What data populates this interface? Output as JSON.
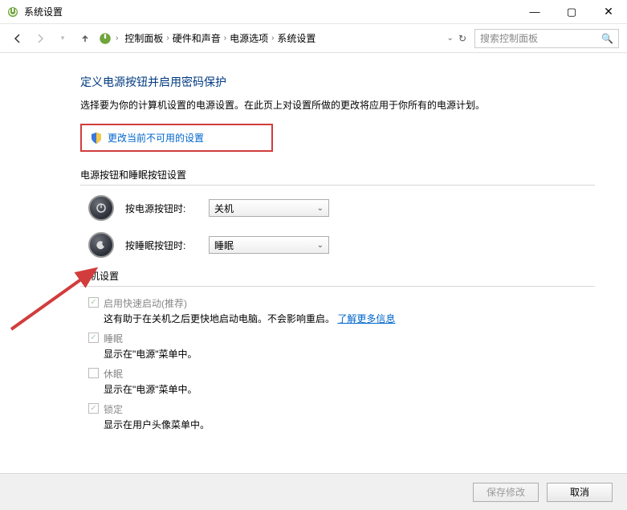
{
  "window": {
    "title": "系统设置"
  },
  "breadcrumb": {
    "items": [
      "控制面板",
      "硬件和声音",
      "电源选项",
      "系统设置"
    ]
  },
  "search": {
    "placeholder": "搜索控制面板"
  },
  "page": {
    "title": "定义电源按钮并启用密码保护",
    "subtitle": "选择要为你的计算机设置的电源设置。在此页上对设置所做的更改将应用于你所有的电源计划。",
    "change_link": "更改当前不可用的设置"
  },
  "sections": {
    "buttons_header": "电源按钮和睡眠按钮设置",
    "power_button_label": "按电源按钮时:",
    "power_button_value": "关机",
    "sleep_button_label": "按睡眠按钮时:",
    "sleep_button_value": "睡眠",
    "shutdown_header": "关机设置"
  },
  "shutdown": {
    "fast_startup": {
      "label": "启用快速启动(推荐)",
      "desc_prefix": "这有助于在关机之后更快地启动电脑。不会影响重启。",
      "learn_more": "了解更多信息"
    },
    "sleep": {
      "label": "睡眠",
      "desc": "显示在\"电源\"菜单中。"
    },
    "hibernate": {
      "label": "休眠",
      "desc": "显示在\"电源\"菜单中。"
    },
    "lock": {
      "label": "锁定",
      "desc": "显示在用户头像菜单中。"
    }
  },
  "footer": {
    "save": "保存修改",
    "cancel": "取消"
  }
}
